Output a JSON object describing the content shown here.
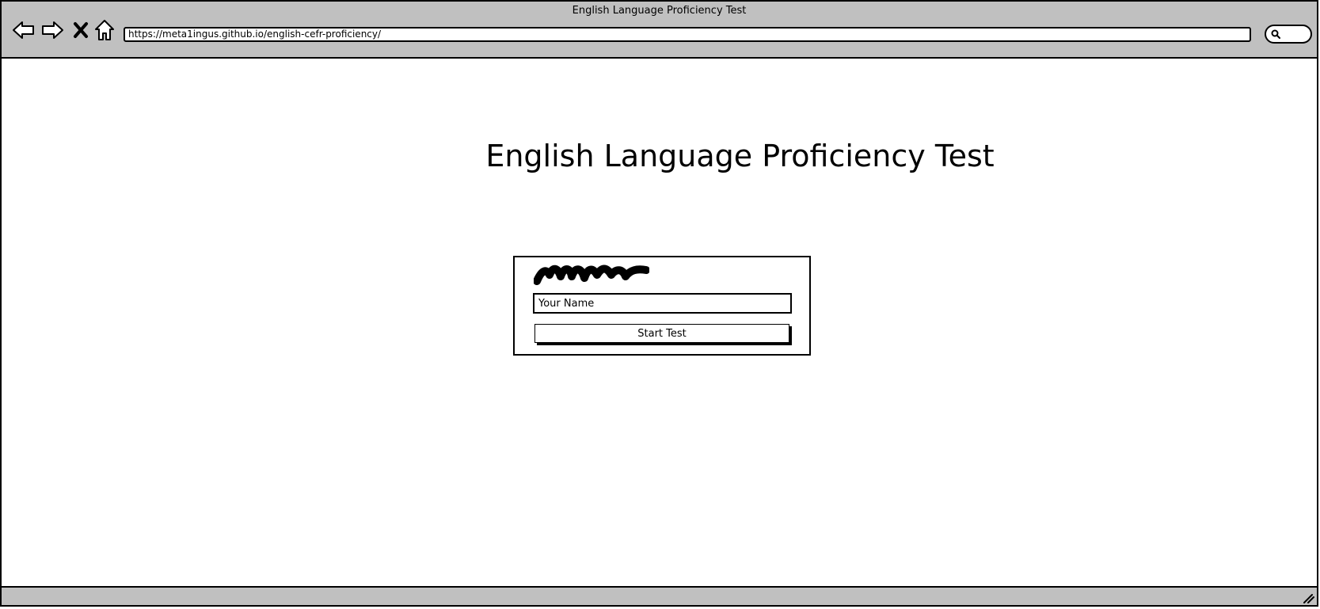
{
  "window": {
    "title": "English Language Proficiency Test",
    "url": "https://meta1ingus.github.io/english-cefr-proficiency/"
  },
  "toolbar": {
    "icons": [
      "back-arrow-icon",
      "forward-arrow-icon",
      "stop-x-icon",
      "home-icon",
      "search-icon"
    ]
  },
  "page": {
    "heading": "English Language Proficiency Test"
  },
  "form": {
    "name_placeholder": "Your Name",
    "name_value": "",
    "start_button_label": "Start Test"
  },
  "colors": {
    "chrome": "#c0c0c0",
    "background": "#ffffff",
    "ink": "#000000"
  }
}
